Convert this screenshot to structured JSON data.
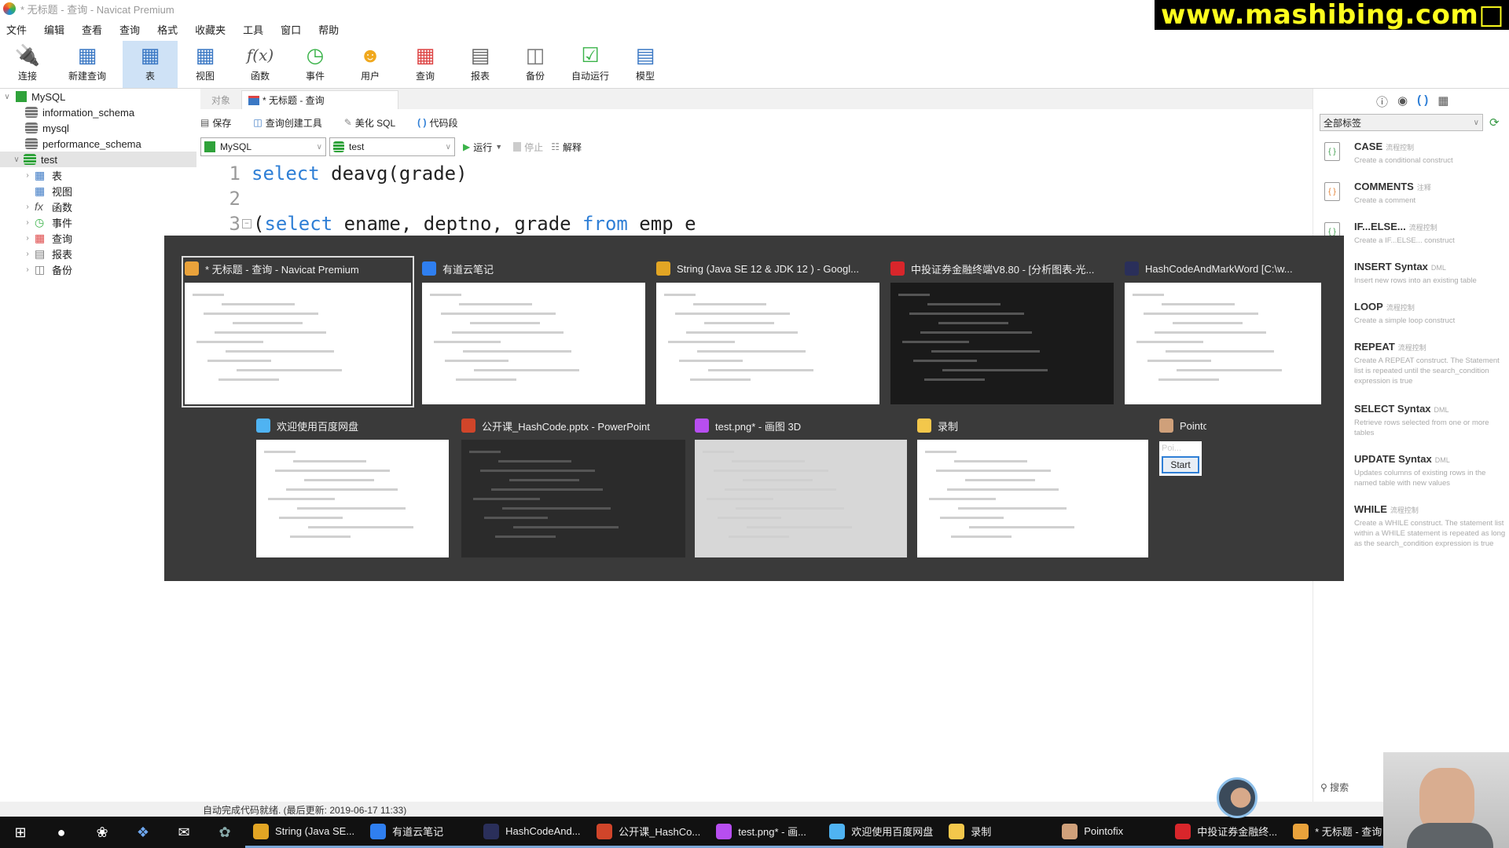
{
  "window": {
    "title": "* 无标题 - 查询 - Navicat Premium"
  },
  "watermark": "www.mashibing.com",
  "menu": [
    "文件",
    "编辑",
    "查看",
    "查询",
    "格式",
    "收藏夹",
    "工具",
    "窗口",
    "帮助"
  ],
  "toolbar": [
    {
      "label": "连接",
      "icon": "connection-icon"
    },
    {
      "label": "新建查询",
      "icon": "new-query-icon"
    },
    {
      "label": "表",
      "icon": "table-icon",
      "active": true
    },
    {
      "label": "视图",
      "icon": "view-icon"
    },
    {
      "label": "函数",
      "icon": "function-icon"
    },
    {
      "label": "事件",
      "icon": "event-clock-icon"
    },
    {
      "label": "用户",
      "icon": "user-icon"
    },
    {
      "label": "查询",
      "icon": "query-icon"
    },
    {
      "label": "报表",
      "icon": "report-icon"
    },
    {
      "label": "备份",
      "icon": "backup-icon"
    },
    {
      "label": "自动运行",
      "icon": "automation-icon"
    },
    {
      "label": "模型",
      "icon": "model-icon"
    }
  ],
  "sidebar": {
    "connection": "MySQL",
    "databases": [
      "information_schema",
      "mysql",
      "performance_schema",
      "test"
    ],
    "test_children": [
      "表",
      "视图",
      "函数",
      "事件",
      "查询",
      "报表",
      "备份"
    ]
  },
  "tabs": {
    "objects": "对象",
    "active": "* 无标题 - 查询"
  },
  "editor_tools": {
    "save": "保存",
    "builder": "查询创建工具",
    "beautify": "美化 SQL",
    "snippet": "代码段"
  },
  "connection_row": {
    "connection": "MySQL",
    "database": "test",
    "run": "运行",
    "stop": "停止",
    "explain": "解释"
  },
  "code": {
    "lines": [
      {
        "n": "1",
        "kw": "select",
        "rest": " deavg(grade)"
      },
      {
        "n": "2",
        "kw": "",
        "rest": ""
      },
      {
        "n": "3",
        "kw": "select",
        "pre": "(",
        "rest": " ename, deptno, grade ",
        "kw2": "from",
        "rest2": " emp e"
      }
    ]
  },
  "right_panel": {
    "filter": "全部标签",
    "snippets": [
      {
        "title": "CASE",
        "tag": "流程控制",
        "desc": "Create a conditional construct"
      },
      {
        "title": "COMMENTS",
        "tag": "注释",
        "desc": "Create a comment"
      },
      {
        "title": "IF...ELSE...",
        "tag": "流程控制",
        "desc": "Create a IF...ELSE... construct"
      },
      {
        "title": "INSERT Syntax",
        "tag": "DML",
        "desc": "Insert new rows into an existing table"
      },
      {
        "title": "LOOP",
        "tag": "流程控制",
        "desc": "Create a simple loop construct"
      },
      {
        "title": "REPEAT",
        "tag": "流程控制",
        "desc": "Create A REPEAT construct. The Statement list is repeated until the search_condition expression is true"
      },
      {
        "title": "SELECT Syntax",
        "tag": "DML",
        "desc": "Retrieve rows selected from one or more tables"
      },
      {
        "title": "UPDATE Syntax",
        "tag": "DML",
        "desc": "Updates columns of existing rows in the named table with new values"
      },
      {
        "title": "WHILE",
        "tag": "流程控制",
        "desc": "Create a WHILE construct. The statement list within a WHILE statement is repeated as long as the search_condition expression is true"
      }
    ]
  },
  "switcher": {
    "windows": [
      {
        "title": "* 无标题 - 查询 - Navicat Premium",
        "color": "#e9a23b",
        "selected": true
      },
      {
        "title": "有道云笔记",
        "color": "#2f7ff0"
      },
      {
        "title": "String (Java SE 12 & JDK 12 ) - Googl...",
        "color": "#e2a524"
      },
      {
        "title": "中投证券金融终端V8.80 - [分析图表-光...",
        "color": "#d8262b"
      },
      {
        "title": "HashCodeAndMarkWord [C:\\w...",
        "color": "#2a2f5a"
      },
      {
        "title": "欢迎使用百度网盘",
        "color": "#4fb3f2"
      },
      {
        "title": "公开课_HashCode.pptx - PowerPoint",
        "color": "#d0452a"
      },
      {
        "title": "test.png* - 画图 3D",
        "color": "#b74ef0"
      },
      {
        "title": "录制",
        "color": "#f3c74b"
      },
      {
        "title": "Pointofix",
        "color": "#cfa07a",
        "button": "Start",
        "field": "Poi..."
      }
    ]
  },
  "statusbar": {
    "text": "自动完成代码就绪. (最后更新: 2019-06-17 11:33)"
  },
  "search_label": "搜索",
  "taskbar": {
    "items": [
      {
        "label": "String (Java SE...",
        "color": "#e2a524"
      },
      {
        "label": "有道云笔记",
        "color": "#2f7ff0"
      },
      {
        "label": "HashCodeAnd...",
        "color": "#2a2f5a"
      },
      {
        "label": "公开课_HashCo...",
        "color": "#d0452a"
      },
      {
        "label": "test.png* - 画...",
        "color": "#b74ef0"
      },
      {
        "label": "欢迎使用百度网盘",
        "color": "#4fb3f2"
      },
      {
        "label": "录制",
        "color": "#f3c74b"
      },
      {
        "label": "Pointofix",
        "color": "#cfa07a"
      },
      {
        "label": "中投证券金融终...",
        "color": "#d8262b"
      },
      {
        "label": "* 无标题 - 查询 ...",
        "color": "#e9a23b"
      }
    ],
    "overflow": "^"
  }
}
